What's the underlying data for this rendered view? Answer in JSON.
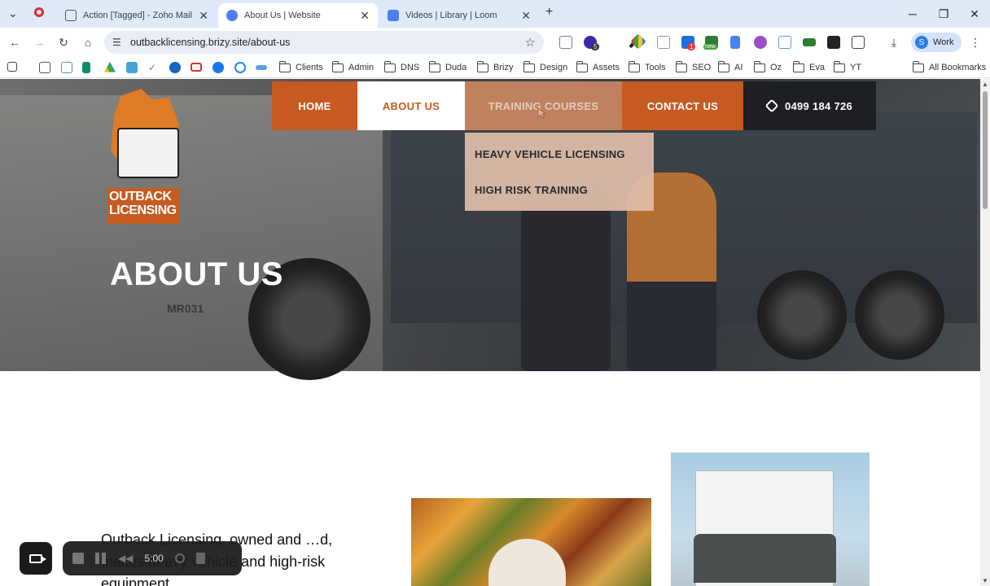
{
  "browser": {
    "tabs": [
      {
        "label": "Action [Tagged] - Zoho Mail (s…",
        "active": false,
        "icon_color": "#555"
      },
      {
        "label": "About Us | Website",
        "active": true,
        "icon_color": "#4f7df3"
      },
      {
        "label": "Videos | Library | Loom",
        "active": false,
        "icon_color": "#4f7df3"
      }
    ],
    "url": "outbacklicensing.brizy.site/about-us",
    "profile_label": "Work",
    "bookmarks": [
      "Clients",
      "Admin",
      "DNS",
      "Duda",
      "Brizy",
      "Design",
      "Assets",
      "Tools",
      "SEO",
      "AI",
      "Oz",
      "Eva",
      "YT"
    ],
    "all_bookmarks_label": "All Bookmarks",
    "extension_badges": {
      "badge_a": "5",
      "badge_b": "1",
      "badge_c": "new"
    }
  },
  "site": {
    "logo": {
      "line1": "OUTBACK",
      "line2": "LICENSING"
    },
    "nav": [
      {
        "label": "HOME",
        "state": "default"
      },
      {
        "label": "ABOUT US",
        "state": "active"
      },
      {
        "label": "TRAINING COURSES",
        "state": "hover"
      },
      {
        "label": "CONTACT US",
        "state": "default"
      }
    ],
    "phone": "0499 184 726",
    "dropdown": [
      "HEAVY VEHICLE LICENSING",
      "HIGH RISK TRAINING"
    ],
    "hero_title": "ABOUT US",
    "truck_plate": "MR031",
    "intro_text": "Outback Licensing, owned and …d, makes heavy vehicle and high-risk equipment"
  },
  "loom": {
    "timer": "5:00"
  },
  "colors": {
    "brand_orange": "#c75a20",
    "dark_nav": "#1d1f22",
    "dropdown_bg": "#e1beaa"
  }
}
